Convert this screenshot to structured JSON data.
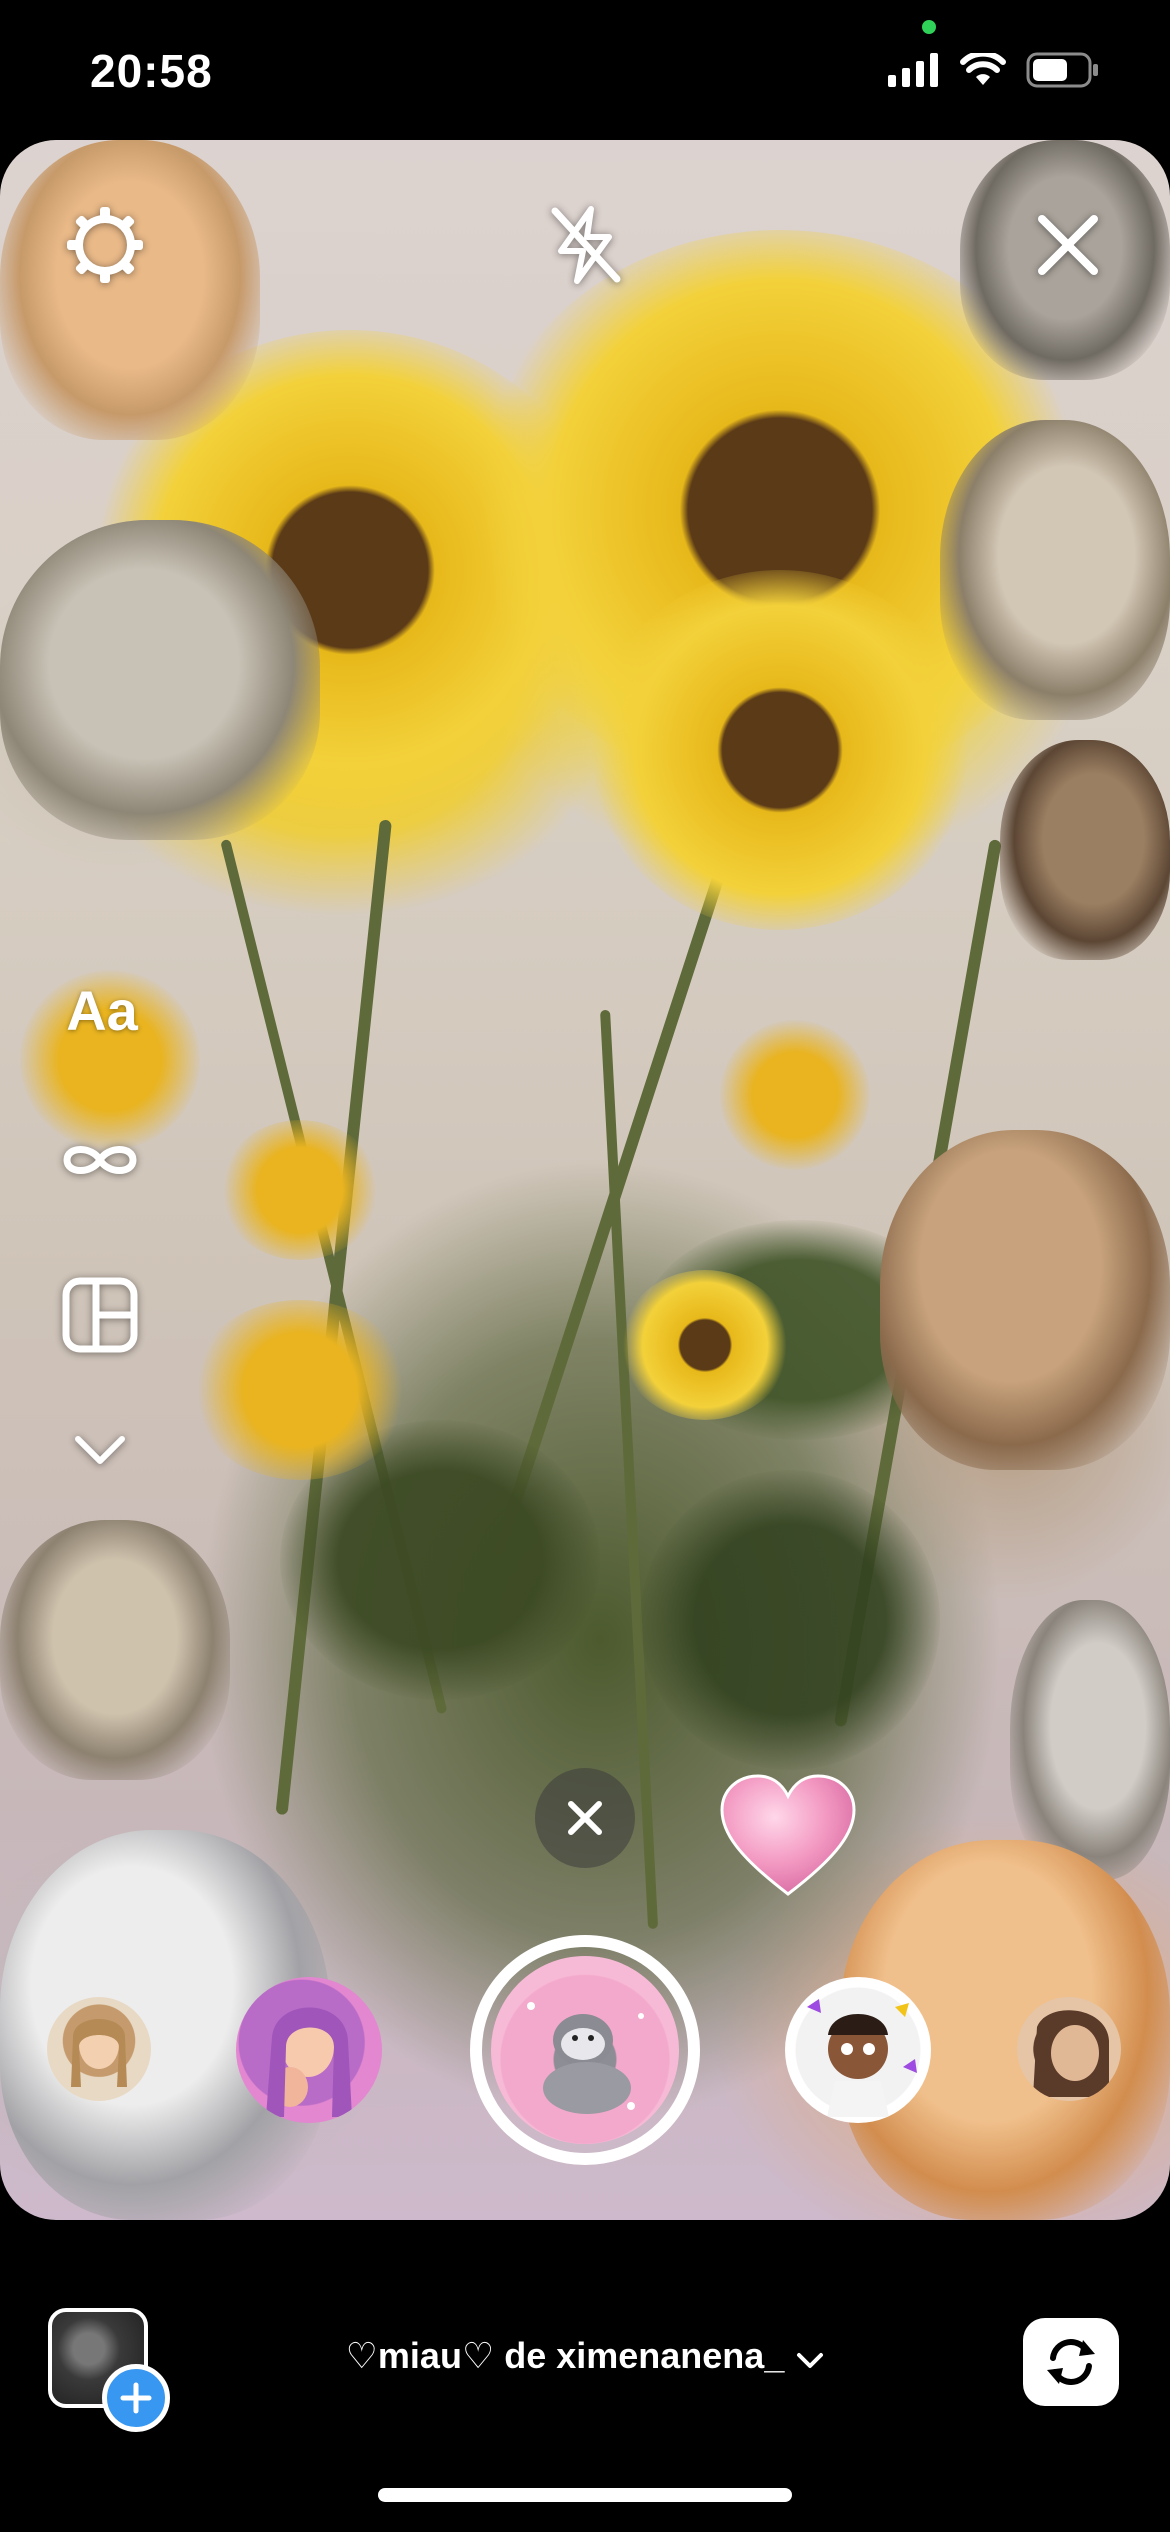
{
  "status_bar": {
    "time": "20:58",
    "privacy_indicator_color": "#30d158",
    "icons": [
      "signal-icon",
      "wifi-icon",
      "battery-icon"
    ]
  },
  "camera": {
    "top_controls": [
      "settings-icon",
      "flash-off-icon",
      "close-icon"
    ],
    "side_tools": {
      "text_tool_label": "Aa",
      "icons": [
        "boomerang-icon",
        "layout-icon",
        "chevron-down-icon"
      ]
    },
    "sticker": "heart-sticker",
    "dismiss_icon": "close-icon"
  },
  "effects": {
    "items": [
      "effect-thumbnail",
      "effect-thumbnail",
      "selected-effect",
      "effect-thumbnail",
      "effect-thumbnail"
    ],
    "selected_name": "♡miau♡ de ximenanena_"
  },
  "bottom_bar": {
    "gallery_icon": "plus-icon",
    "flip_icon": "flip-camera-icon"
  },
  "colors": {
    "accent_blue": "#3897f0",
    "heart_pink": "#f39ac2",
    "capture_ring": "#ffffff"
  }
}
